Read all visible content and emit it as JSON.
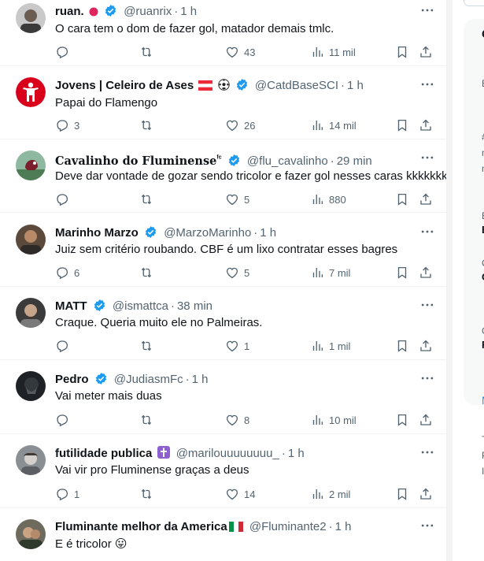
{
  "tweets": [
    {
      "name": "ruan.",
      "handle": "@ruanrix",
      "time": "1 h",
      "text": "O cara tem o dom de fazer gol, matador demais tmlc.",
      "replies": "",
      "likes": "43",
      "views": "11 mil"
    },
    {
      "name": "Jovens | Celeiro de Ases",
      "handle": "@CatdBaseSCI",
      "time": "1 h",
      "text": "Papai do Flamengo",
      "replies": "3",
      "likes": "26",
      "views": "14 mil"
    },
    {
      "name": "Cavalinho do Fluminense",
      "name_sup": "ᶠᶜ",
      "handle": "@flu_cavalinho",
      "time": "29 min",
      "text": "Deve dar vontade de gozar sendo tricolor e fazer gol nesses caras kkkkkkk",
      "replies": "",
      "likes": "5",
      "views": "880"
    },
    {
      "name": "Marinho Marzo",
      "handle": "@MarzoMarinho",
      "time": "1 h",
      "text": "Juiz sem critério roubando. CBF é um lixo contratar esses bagres",
      "replies": "6",
      "likes": "5",
      "views": "7 mil"
    },
    {
      "name": "MATT",
      "handle": "@ismattca",
      "time": "38 min",
      "text": "Craque. Queria muito ele no Palmeiras.",
      "replies": "",
      "likes": "1",
      "views": "1 mil"
    },
    {
      "name": "Pedro",
      "handle": "@JudiasmFc",
      "time": "1 h",
      "text": "Vai meter mais duas",
      "replies": "",
      "likes": "8",
      "views": "10 mil"
    },
    {
      "name": "futilidade publica",
      "handle": "@marilouuuuuuuu_",
      "time": "1 h",
      "text": "Vai vir pro Fluminense graças a deus",
      "replies": "1",
      "likes": "14",
      "views": "2 mil"
    },
    {
      "name": "Fluminante melhor da America",
      "handle": "@Fluminante2",
      "time": "1 h",
      "text": "E é tricolor 😛",
      "replies": "",
      "likes": "",
      "views": ""
    }
  ],
  "sidebar_letters": [
    "C",
    "E",
    "#",
    "n",
    "n",
    "E",
    "E",
    "C",
    "C",
    "C",
    "F",
    "M",
    "T",
    "P",
    "I"
  ],
  "colors": {
    "verified": "#1d9bf0",
    "muted": "#536471",
    "text": "#0f1419",
    "divider": "#eff3f4"
  },
  "icons": {
    "reply": "reply-icon",
    "retweet": "retweet-icon",
    "like": "heart-icon",
    "views": "views-icon",
    "bookmark": "bookmark-icon",
    "share": "share-icon",
    "more": "more-icon",
    "verified": "verified-badge-icon"
  }
}
